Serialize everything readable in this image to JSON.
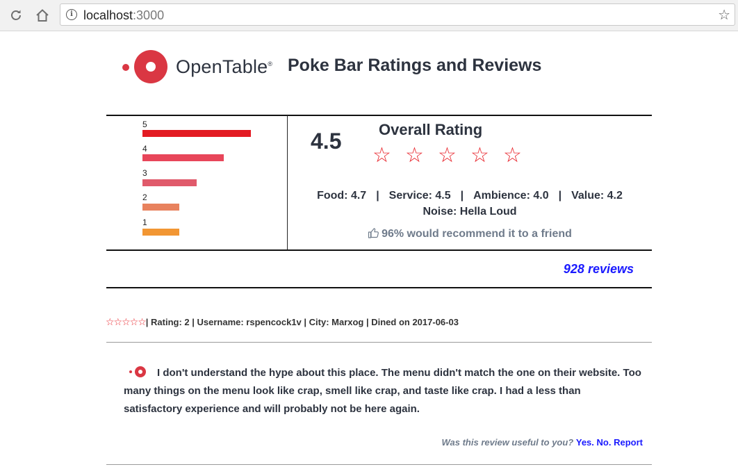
{
  "browser": {
    "url_host": "localhost",
    "url_port": ":3000"
  },
  "header": {
    "logo_text": "OpenTable",
    "logo_mark": "®",
    "title": "Poke Bar Ratings and Reviews"
  },
  "rating_bars": [
    {
      "label": "5",
      "fraction": 0.4,
      "color": "#e31b23"
    },
    {
      "label": "4",
      "fraction": 0.3,
      "color": "#e8465a"
    },
    {
      "label": "3",
      "fraction": 0.2,
      "color": "#e05a6b"
    },
    {
      "label": "2",
      "fraction": 0.135,
      "color": "#e8825e"
    },
    {
      "label": "1",
      "fraction": 0.135,
      "color": "#f29633"
    }
  ],
  "summary": {
    "score": "4.5",
    "overall_label": "Overall Rating",
    "stars": [
      "☆",
      "☆",
      "☆",
      "☆",
      "☆"
    ],
    "food": "Food: 4.7",
    "service": "Service: 4.5",
    "ambience": "Ambience: 4.0",
    "value": "Value: 4.2",
    "separator": "|",
    "noise": "Noise: Hella Loud",
    "recommend": "96% would recommend it to a friend",
    "review_count": "928 reviews"
  },
  "review": {
    "stars": "☆☆☆☆☆",
    "meta": "| Rating: 2 | Username: rspencock1v | City: Marxog | Dined on 2017-06-03",
    "body": "I don't understand the hype about this place. The menu didn't match the one on their website. Too many things on the menu look like crap, smell like crap, and taste like crap. I had a less than satisfactory experience and will probably not be here again.",
    "useful_question": "Was this review useful to you?",
    "yes": "Yes.",
    "no": "No.",
    "report": "Report"
  },
  "colors": {
    "brand_red": "#da3743",
    "star_red": "#e8262d",
    "link_blue": "#1a1aff"
  }
}
